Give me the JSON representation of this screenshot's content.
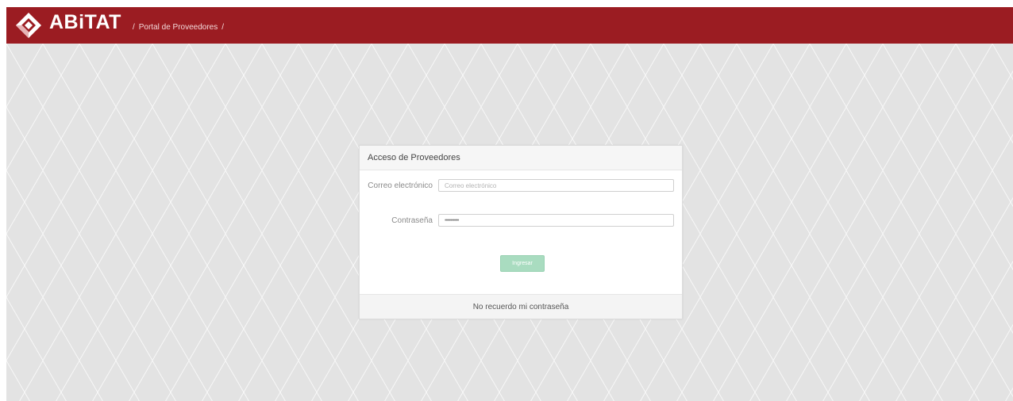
{
  "header": {
    "brand_name": "ABiTAT",
    "brand_tagline": "",
    "breadcrumb_separator_1": "/",
    "breadcrumb_item": "Portal de Proveedores",
    "breadcrumb_separator_2": "/"
  },
  "login": {
    "title": "Acceso de Proveedores",
    "email_label": "Correo electrónico",
    "email_placeholder": "Correo electrónico",
    "password_label": "Contraseña",
    "password_value": "••••••••••••",
    "submit_label": "Ingresar",
    "forgot_link": "No recuerdo mi contraseña"
  },
  "colors": {
    "brand_red": "#9b1c22",
    "button_green": "#a9dcc0",
    "background": "#e4e4e4"
  },
  "icons": {
    "logo": "abitat-diamond-logo-icon"
  }
}
